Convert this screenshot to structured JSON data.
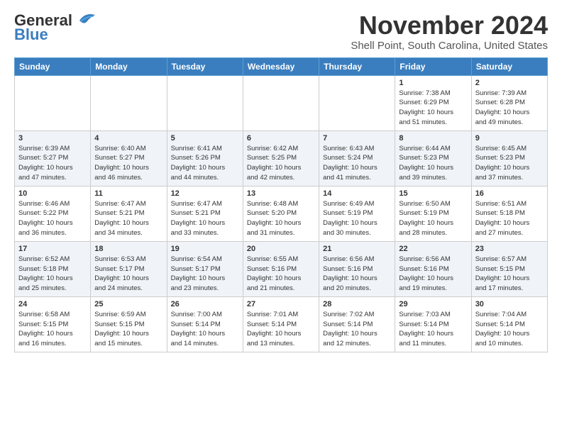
{
  "header": {
    "logo_line1": "General",
    "logo_line2": "Blue",
    "month_year": "November 2024",
    "location": "Shell Point, South Carolina, United States"
  },
  "weekdays": [
    "Sunday",
    "Monday",
    "Tuesday",
    "Wednesday",
    "Thursday",
    "Friday",
    "Saturday"
  ],
  "weeks": [
    [
      {
        "day": "",
        "info": ""
      },
      {
        "day": "",
        "info": ""
      },
      {
        "day": "",
        "info": ""
      },
      {
        "day": "",
        "info": ""
      },
      {
        "day": "",
        "info": ""
      },
      {
        "day": "1",
        "info": "Sunrise: 7:38 AM\nSunset: 6:29 PM\nDaylight: 10 hours\nand 51 minutes."
      },
      {
        "day": "2",
        "info": "Sunrise: 7:39 AM\nSunset: 6:28 PM\nDaylight: 10 hours\nand 49 minutes."
      }
    ],
    [
      {
        "day": "3",
        "info": "Sunrise: 6:39 AM\nSunset: 5:27 PM\nDaylight: 10 hours\nand 47 minutes."
      },
      {
        "day": "4",
        "info": "Sunrise: 6:40 AM\nSunset: 5:27 PM\nDaylight: 10 hours\nand 46 minutes."
      },
      {
        "day": "5",
        "info": "Sunrise: 6:41 AM\nSunset: 5:26 PM\nDaylight: 10 hours\nand 44 minutes."
      },
      {
        "day": "6",
        "info": "Sunrise: 6:42 AM\nSunset: 5:25 PM\nDaylight: 10 hours\nand 42 minutes."
      },
      {
        "day": "7",
        "info": "Sunrise: 6:43 AM\nSunset: 5:24 PM\nDaylight: 10 hours\nand 41 minutes."
      },
      {
        "day": "8",
        "info": "Sunrise: 6:44 AM\nSunset: 5:23 PM\nDaylight: 10 hours\nand 39 minutes."
      },
      {
        "day": "9",
        "info": "Sunrise: 6:45 AM\nSunset: 5:23 PM\nDaylight: 10 hours\nand 37 minutes."
      }
    ],
    [
      {
        "day": "10",
        "info": "Sunrise: 6:46 AM\nSunset: 5:22 PM\nDaylight: 10 hours\nand 36 minutes."
      },
      {
        "day": "11",
        "info": "Sunrise: 6:47 AM\nSunset: 5:21 PM\nDaylight: 10 hours\nand 34 minutes."
      },
      {
        "day": "12",
        "info": "Sunrise: 6:47 AM\nSunset: 5:21 PM\nDaylight: 10 hours\nand 33 minutes."
      },
      {
        "day": "13",
        "info": "Sunrise: 6:48 AM\nSunset: 5:20 PM\nDaylight: 10 hours\nand 31 minutes."
      },
      {
        "day": "14",
        "info": "Sunrise: 6:49 AM\nSunset: 5:19 PM\nDaylight: 10 hours\nand 30 minutes."
      },
      {
        "day": "15",
        "info": "Sunrise: 6:50 AM\nSunset: 5:19 PM\nDaylight: 10 hours\nand 28 minutes."
      },
      {
        "day": "16",
        "info": "Sunrise: 6:51 AM\nSunset: 5:18 PM\nDaylight: 10 hours\nand 27 minutes."
      }
    ],
    [
      {
        "day": "17",
        "info": "Sunrise: 6:52 AM\nSunset: 5:18 PM\nDaylight: 10 hours\nand 25 minutes."
      },
      {
        "day": "18",
        "info": "Sunrise: 6:53 AM\nSunset: 5:17 PM\nDaylight: 10 hours\nand 24 minutes."
      },
      {
        "day": "19",
        "info": "Sunrise: 6:54 AM\nSunset: 5:17 PM\nDaylight: 10 hours\nand 23 minutes."
      },
      {
        "day": "20",
        "info": "Sunrise: 6:55 AM\nSunset: 5:16 PM\nDaylight: 10 hours\nand 21 minutes."
      },
      {
        "day": "21",
        "info": "Sunrise: 6:56 AM\nSunset: 5:16 PM\nDaylight: 10 hours\nand 20 minutes."
      },
      {
        "day": "22",
        "info": "Sunrise: 6:56 AM\nSunset: 5:16 PM\nDaylight: 10 hours\nand 19 minutes."
      },
      {
        "day": "23",
        "info": "Sunrise: 6:57 AM\nSunset: 5:15 PM\nDaylight: 10 hours\nand 17 minutes."
      }
    ],
    [
      {
        "day": "24",
        "info": "Sunrise: 6:58 AM\nSunset: 5:15 PM\nDaylight: 10 hours\nand 16 minutes."
      },
      {
        "day": "25",
        "info": "Sunrise: 6:59 AM\nSunset: 5:15 PM\nDaylight: 10 hours\nand 15 minutes."
      },
      {
        "day": "26",
        "info": "Sunrise: 7:00 AM\nSunset: 5:14 PM\nDaylight: 10 hours\nand 14 minutes."
      },
      {
        "day": "27",
        "info": "Sunrise: 7:01 AM\nSunset: 5:14 PM\nDaylight: 10 hours\nand 13 minutes."
      },
      {
        "day": "28",
        "info": "Sunrise: 7:02 AM\nSunset: 5:14 PM\nDaylight: 10 hours\nand 12 minutes."
      },
      {
        "day": "29",
        "info": "Sunrise: 7:03 AM\nSunset: 5:14 PM\nDaylight: 10 hours\nand 11 minutes."
      },
      {
        "day": "30",
        "info": "Sunrise: 7:04 AM\nSunset: 5:14 PM\nDaylight: 10 hours\nand 10 minutes."
      }
    ]
  ]
}
